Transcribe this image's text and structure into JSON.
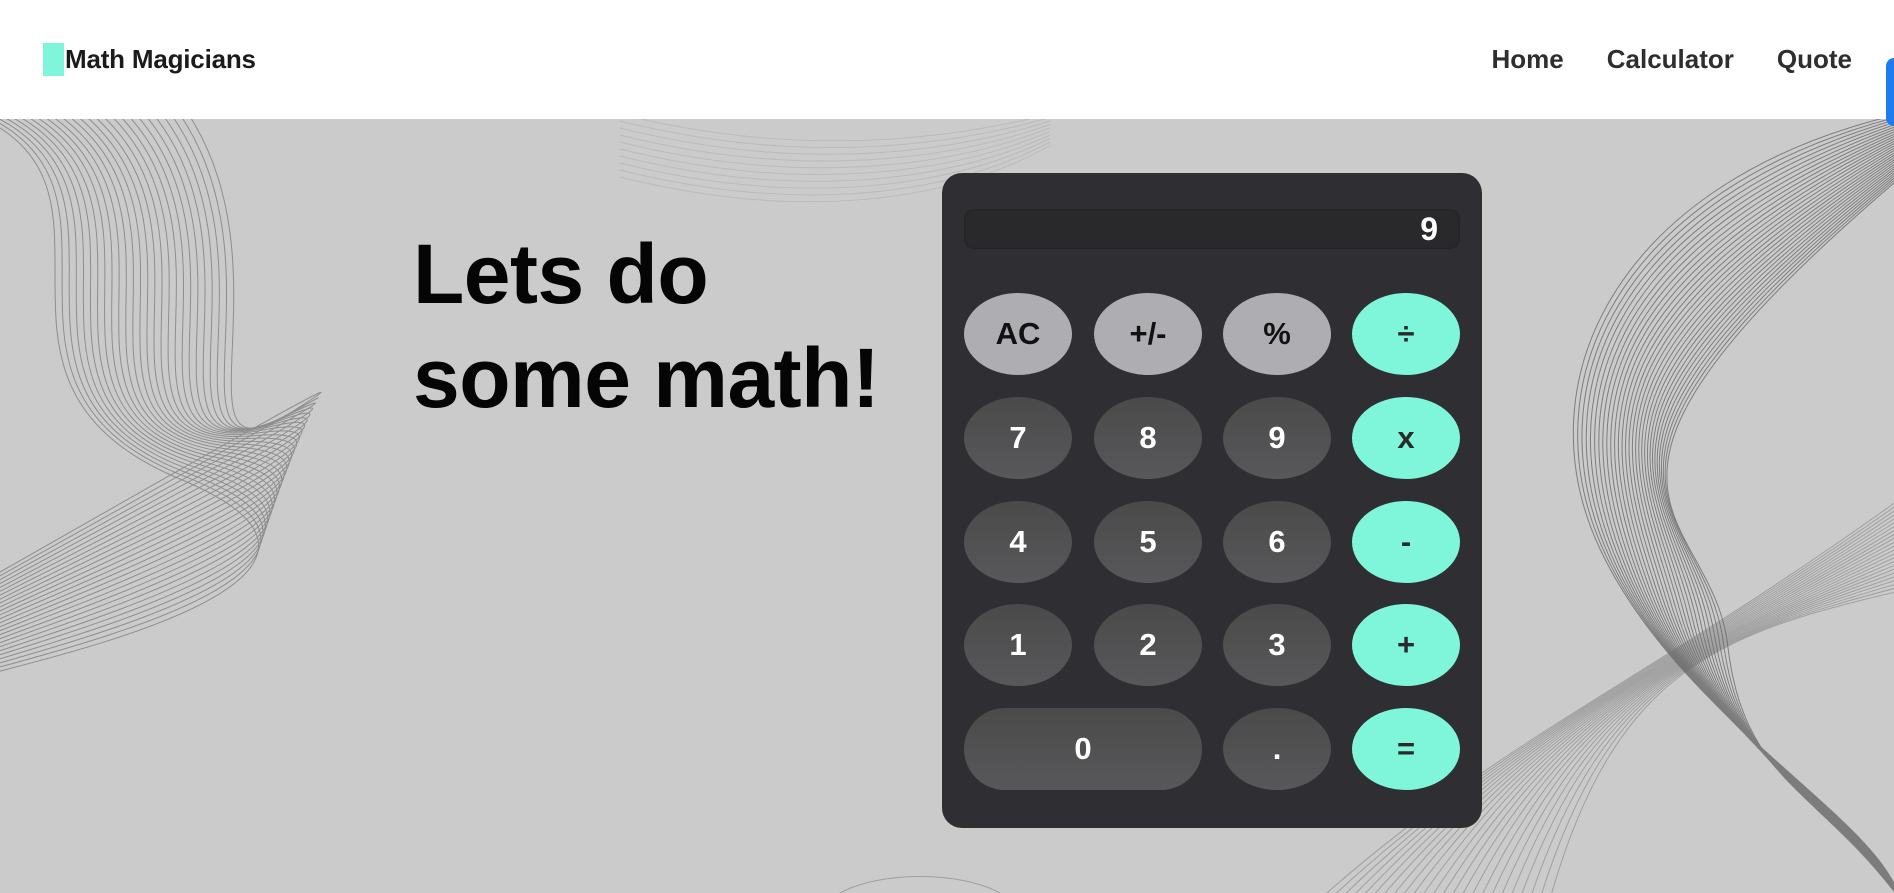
{
  "header": {
    "logo_text": "Math Magicians",
    "nav": [
      "Home",
      "Calculator",
      "Quote"
    ]
  },
  "hero": {
    "line1": "Lets do",
    "line2": "some math!"
  },
  "calculator": {
    "display": "9",
    "keys": {
      "ac": "AC",
      "sign": "+/-",
      "percent": "%",
      "divide": "÷",
      "seven": "7",
      "eight": "8",
      "nine": "9",
      "multiply": "x",
      "four": "4",
      "five": "5",
      "six": "6",
      "minus": "-",
      "one": "1",
      "two": "2",
      "three": "3",
      "plus": "+",
      "zero": "0",
      "dot": ".",
      "equals": "="
    }
  },
  "colors": {
    "accent": "#7ff5d9",
    "calculator_body": "#2f2f33",
    "function_key": "#aeadb1",
    "page_background": "#cbcbcb"
  }
}
